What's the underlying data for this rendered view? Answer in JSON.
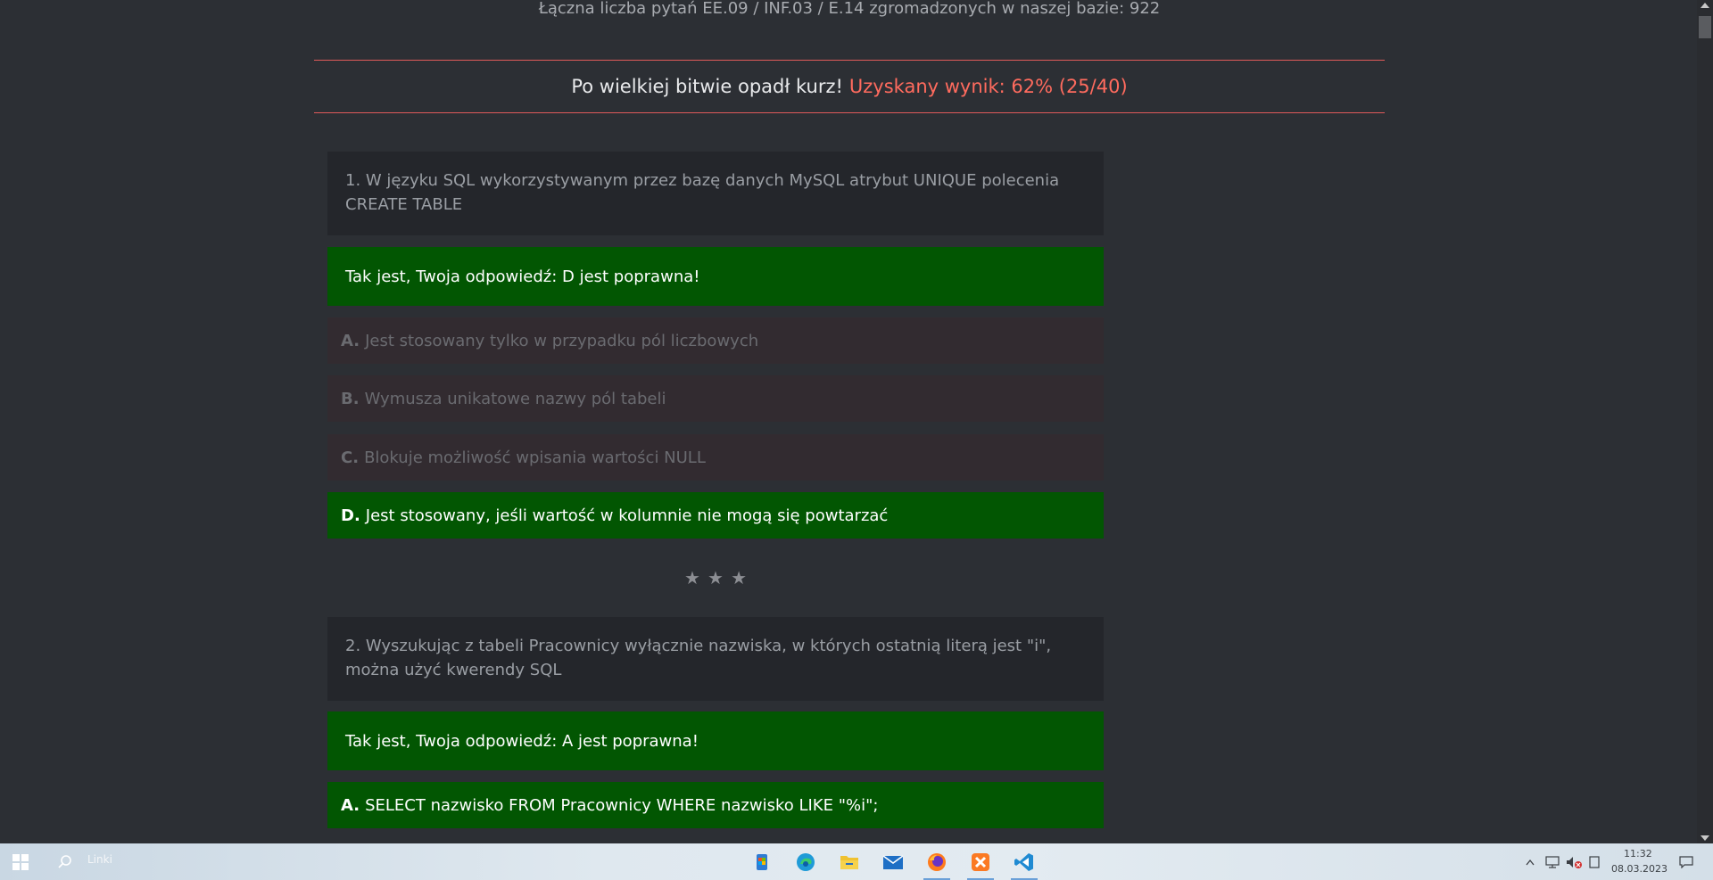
{
  "header": {
    "total_questions": "Łączna liczba pytań EE.09 / INF.03 / E.14 zgromadzonych w naszej bazie: 922",
    "result_message": "Po wielkiej bitwie opadł kurz!",
    "result_score": "Uzyskany wynik: 62% (25/40)"
  },
  "questions": [
    {
      "text": "1. W języku SQL wykorzystywanym przez bazę danych MySQL atrybut UNIQUE polecenia CREATE TABLE",
      "feedback": "Tak jest, Twoja odpowiedź: D jest poprawna!",
      "options": [
        {
          "letter": "A.",
          "text": "Jest stosowany tylko w przypadku pól liczbowych"
        },
        {
          "letter": "B.",
          "text": "Wymusza unikatowe nazwy pól tabeli"
        },
        {
          "letter": "C.",
          "text": "Blokuje możliwość wpisania wartości NULL"
        },
        {
          "letter": "D.",
          "text": "Jest stosowany, jeśli wartość w kolumnie nie mogą się powtarzać"
        }
      ],
      "correct_letter": "D."
    },
    {
      "text": "2. Wyszukując z tabeli Pracownicy wyłącznie nazwiska, w których ostatnią literą jest \"i\", można użyć kwerendy SQL",
      "feedback": "Tak jest, Twoja odpowiedź: A jest poprawna!",
      "options": [
        {
          "letter": "A.",
          "text": "SELECT nazwisko FROM Pracownicy WHERE nazwisko LIKE \"%i\";"
        }
      ],
      "correct_letter": "A."
    }
  ],
  "separator": [
    "★",
    "★",
    "★"
  ],
  "colors": {
    "correct": "#025602",
    "accent": "#ff6b5e",
    "background": "#2c2f34"
  },
  "taskbar": {
    "search_placeholder": "Linki",
    "apps": [
      "start-icon",
      "search-icon",
      "store-icon",
      "edge-icon",
      "file-explorer-icon",
      "mail-icon",
      "firefox-icon",
      "xampp-icon",
      "vscode-icon"
    ],
    "time": "11:32",
    "date": "08.03.2023"
  }
}
